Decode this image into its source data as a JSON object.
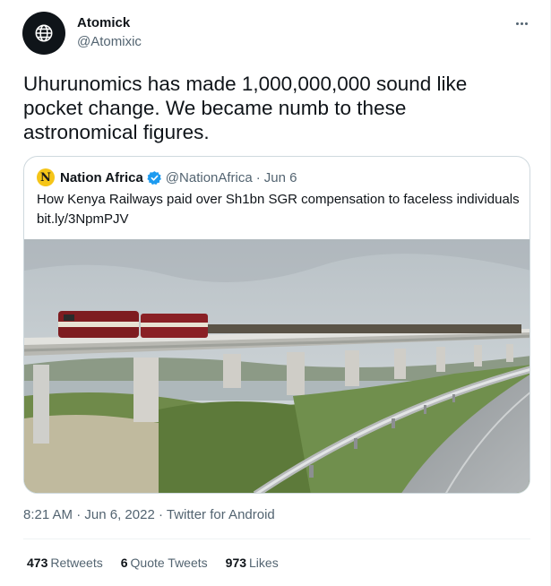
{
  "author": {
    "name": "Atomick",
    "handle": "@Atomixic"
  },
  "tweet": {
    "text": "Uhurunomics has made 1,000,000,000 sound like pocket change. We became numb to these astronomical figures."
  },
  "quote": {
    "logo_letter": "N",
    "name": "Nation Africa",
    "handle": "@NationAfrica",
    "separator": "·",
    "date": "Jun 6",
    "text": "How Kenya Railways paid over Sh1bn SGR compensation to faceless individuals",
    "link": "bit.ly/3NpmPJV"
  },
  "meta": {
    "time": "8:21 AM",
    "separator": "·",
    "date": "Jun 6, 2022",
    "source": "Twitter for Android"
  },
  "stats": {
    "retweets_count": "473",
    "retweets_label": "Retweets",
    "quotes_count": "6",
    "quotes_label": "Quote Tweets",
    "likes_count": "973",
    "likes_label": "Likes"
  },
  "icons": {
    "avatar": "globe-icon",
    "verified": "verified-badge-icon",
    "more": "more-dots-icon"
  },
  "colors": {
    "text_primary": "#0f1419",
    "text_secondary": "#536471",
    "border": "#cfd9de",
    "verified_blue": "#1d9bf0",
    "logo_yellow": "#f5c518"
  }
}
